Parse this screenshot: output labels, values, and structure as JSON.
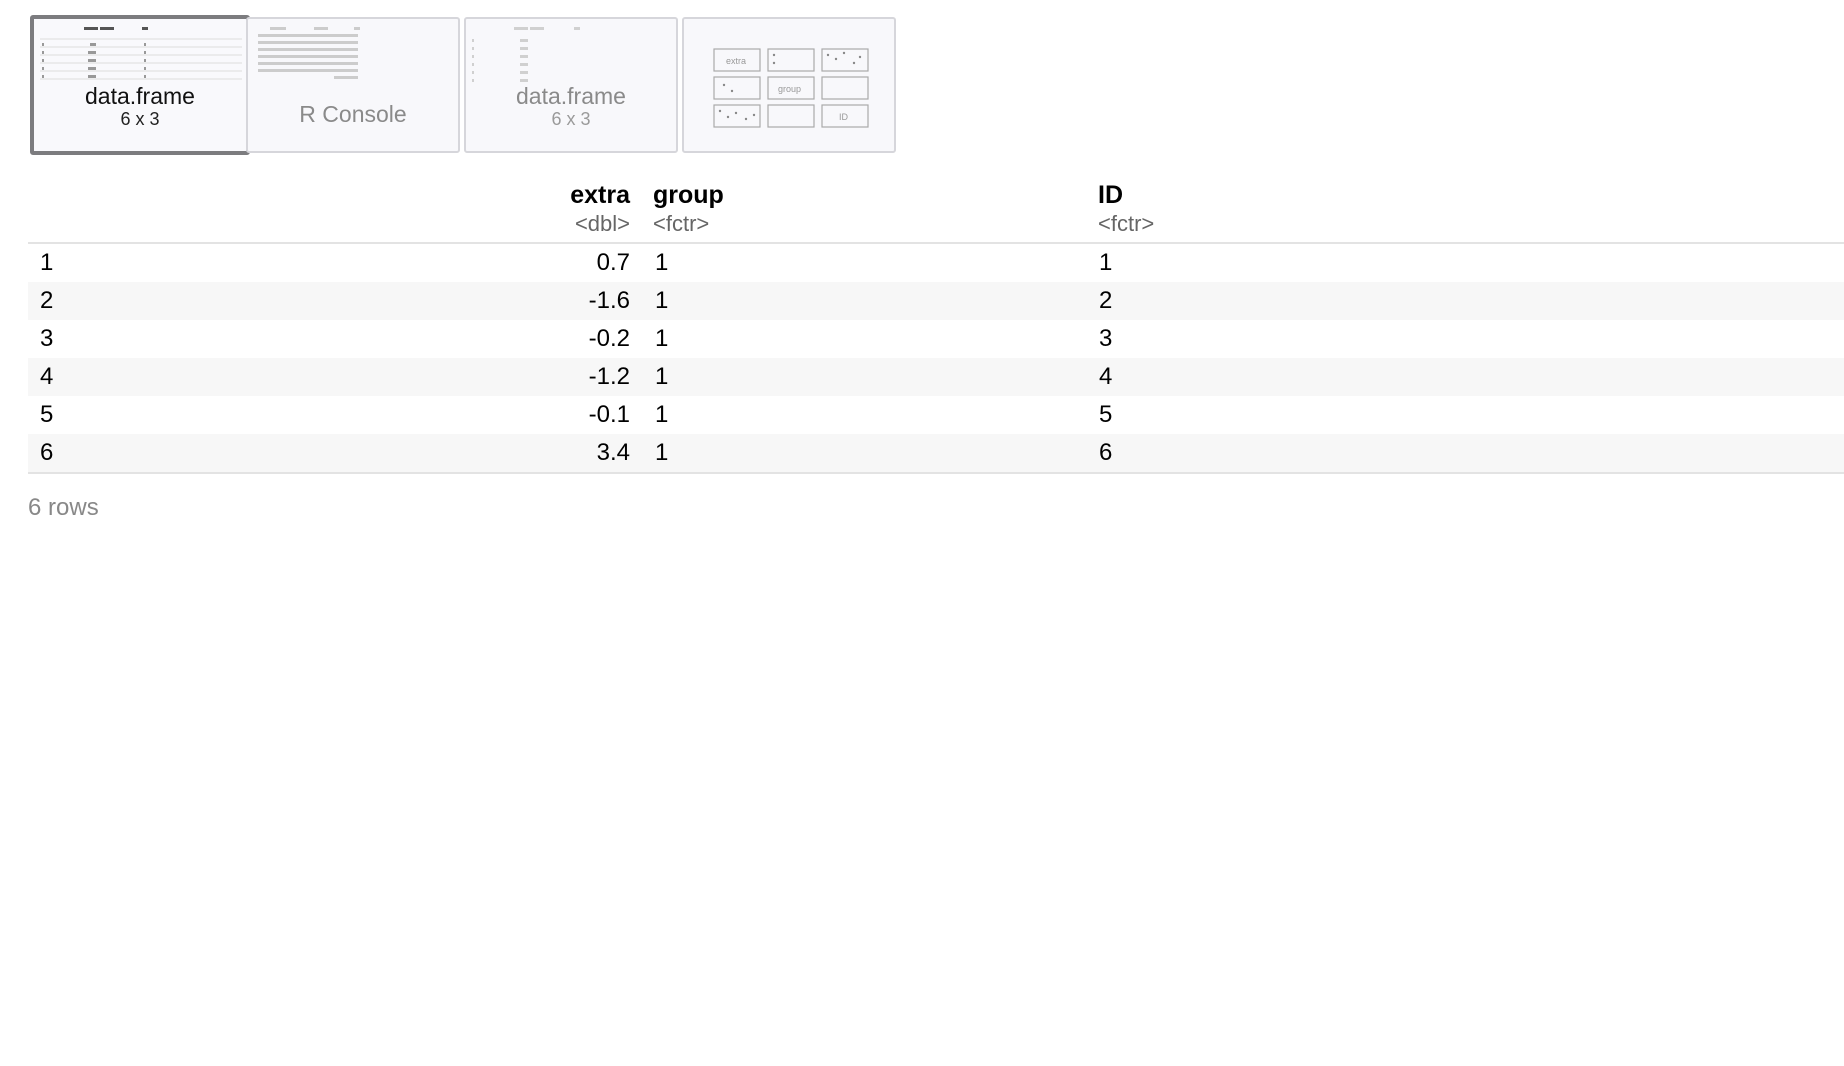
{
  "tabs": [
    {
      "title": "data.frame",
      "subtitle": "6 x 3",
      "active": true
    },
    {
      "title": "R Console",
      "subtitle": "",
      "active": false
    },
    {
      "title": "data.frame",
      "subtitle": "6 x 3",
      "active": false
    },
    {
      "title": "",
      "subtitle": "",
      "active": false
    }
  ],
  "table": {
    "columns": [
      {
        "name": "extra",
        "type": "<dbl>"
      },
      {
        "name": "group",
        "type": "<fctr>"
      },
      {
        "name": "ID",
        "type": "<fctr>"
      }
    ],
    "rows": [
      {
        "index": "1",
        "extra": "0.7",
        "group": "1",
        "id": "1"
      },
      {
        "index": "2",
        "extra": "-1.6",
        "group": "1",
        "id": "2"
      },
      {
        "index": "3",
        "extra": "-0.2",
        "group": "1",
        "id": "3"
      },
      {
        "index": "4",
        "extra": "-1.2",
        "group": "1",
        "id": "4"
      },
      {
        "index": "5",
        "extra": "-0.1",
        "group": "1",
        "id": "5"
      },
      {
        "index": "6",
        "extra": "3.4",
        "group": "1",
        "id": "6"
      }
    ],
    "footer": "6 rows"
  },
  "plot_thumbnail": {
    "panel_labels": [
      "extra",
      "group",
      "ID"
    ]
  }
}
